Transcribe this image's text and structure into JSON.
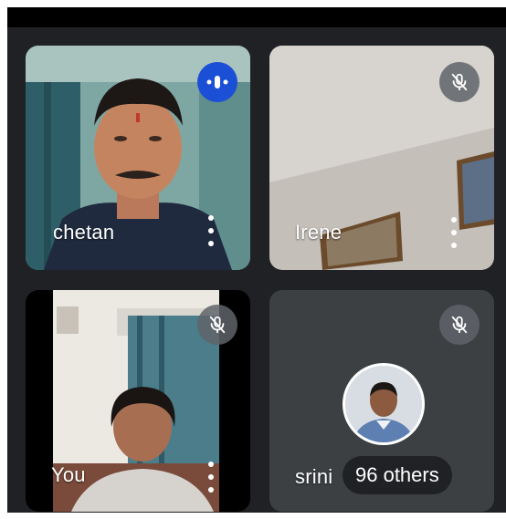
{
  "participants": [
    {
      "name": "chetan",
      "state": "speaking",
      "status_icon": "speaking-indicator-icon"
    },
    {
      "name": "Irene",
      "state": "muted",
      "status_icon": "mic-off-icon"
    },
    {
      "name": "You",
      "state": "muted",
      "status_icon": "mic-off-icon"
    },
    {
      "name": "srini",
      "state": "muted",
      "status_icon": "mic-off-icon"
    }
  ],
  "others_label": "96 others",
  "colors": {
    "background": "#202124",
    "tile": "#3c4043",
    "speaking_accent": "#1a4fd6"
  }
}
